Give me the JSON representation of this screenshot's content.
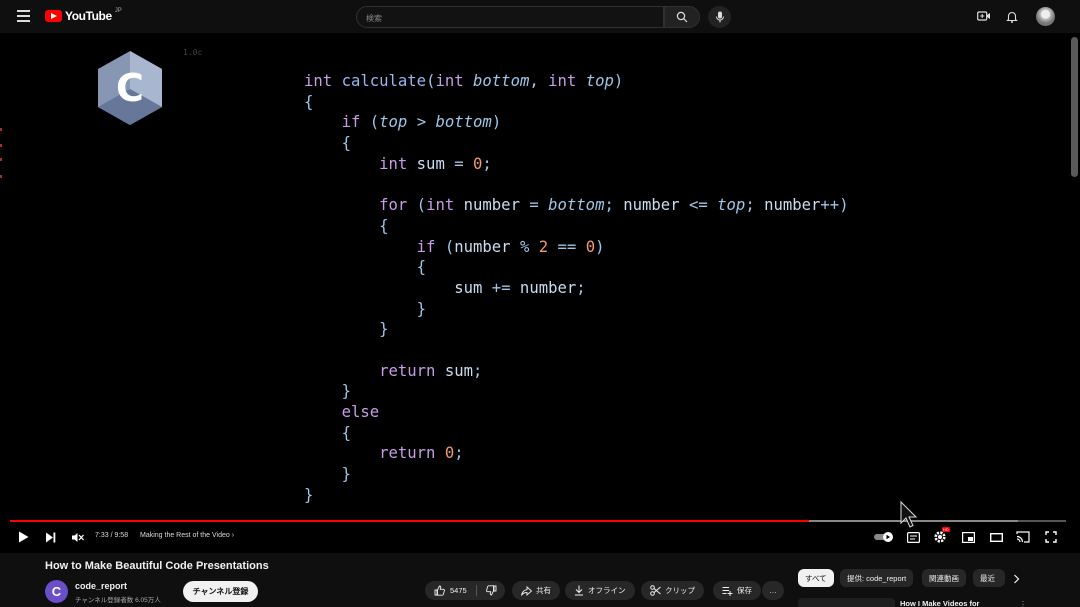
{
  "header": {
    "logo_text": "YouTube",
    "region": "JP",
    "search_placeholder": "検索"
  },
  "video": {
    "code_title": "1.0c",
    "logo_letter": "C",
    "code_lines": [
      [
        [
          "kw",
          "int"
        ],
        [
          "plain",
          " "
        ],
        [
          "fn",
          "calculate"
        ],
        [
          "punct",
          "("
        ],
        [
          "kw",
          "int"
        ],
        [
          "plain",
          " "
        ],
        [
          "param",
          "bottom"
        ],
        [
          "punct",
          ", "
        ],
        [
          "kw",
          "int"
        ],
        [
          "plain",
          " "
        ],
        [
          "param",
          "top"
        ],
        [
          "punct",
          ")"
        ]
      ],
      [
        [
          "punct",
          "{"
        ]
      ],
      [
        [
          "plain",
          "    "
        ],
        [
          "kw",
          "if"
        ],
        [
          "plain",
          " "
        ],
        [
          "punct",
          "("
        ],
        [
          "param",
          "top"
        ],
        [
          "plain",
          " "
        ],
        [
          "punct",
          ">"
        ],
        [
          "plain",
          " "
        ],
        [
          "param",
          "bottom"
        ],
        [
          "punct",
          ")"
        ]
      ],
      [
        [
          "plain",
          "    "
        ],
        [
          "punct",
          "{"
        ]
      ],
      [
        [
          "plain",
          "        "
        ],
        [
          "kw",
          "int"
        ],
        [
          "plain",
          " sum "
        ],
        [
          "punct",
          "="
        ],
        [
          "plain",
          " "
        ],
        [
          "num",
          "0"
        ],
        [
          "punct",
          ";"
        ]
      ],
      [],
      [
        [
          "plain",
          "        "
        ],
        [
          "kw",
          "for"
        ],
        [
          "plain",
          " "
        ],
        [
          "punct",
          "("
        ],
        [
          "kw",
          "int"
        ],
        [
          "plain",
          " number "
        ],
        [
          "punct",
          "="
        ],
        [
          "plain",
          " "
        ],
        [
          "param",
          "bottom"
        ],
        [
          "punct",
          ";"
        ],
        [
          "plain",
          " number "
        ],
        [
          "punct",
          "<="
        ],
        [
          "plain",
          " "
        ],
        [
          "param",
          "top"
        ],
        [
          "punct",
          ";"
        ],
        [
          "plain",
          " number"
        ],
        [
          "punct",
          "++)"
        ]
      ],
      [
        [
          "plain",
          "        "
        ],
        [
          "punct",
          "{"
        ]
      ],
      [
        [
          "plain",
          "            "
        ],
        [
          "kw",
          "if"
        ],
        [
          "plain",
          " "
        ],
        [
          "punct",
          "("
        ],
        [
          "plain",
          "number "
        ],
        [
          "punct",
          "%"
        ],
        [
          "plain",
          " "
        ],
        [
          "num",
          "2"
        ],
        [
          "plain",
          " "
        ],
        [
          "punct",
          "=="
        ],
        [
          "plain",
          " "
        ],
        [
          "num",
          "0"
        ],
        [
          "punct",
          ")"
        ]
      ],
      [
        [
          "plain",
          "            "
        ],
        [
          "punct",
          "{"
        ]
      ],
      [
        [
          "plain",
          "                sum "
        ],
        [
          "punct",
          "+="
        ],
        [
          "plain",
          " number"
        ],
        [
          "punct",
          ";"
        ]
      ],
      [
        [
          "plain",
          "            "
        ],
        [
          "punct",
          "}"
        ]
      ],
      [
        [
          "plain",
          "        "
        ],
        [
          "punct",
          "}"
        ]
      ],
      [],
      [
        [
          "plain",
          "        "
        ],
        [
          "kw",
          "return"
        ],
        [
          "plain",
          " sum"
        ],
        [
          "punct",
          ";"
        ]
      ],
      [
        [
          "plain",
          "    "
        ],
        [
          "punct",
          "}"
        ]
      ],
      [
        [
          "plain",
          "    "
        ],
        [
          "kw",
          "else"
        ]
      ],
      [
        [
          "plain",
          "    "
        ],
        [
          "punct",
          "{"
        ]
      ],
      [
        [
          "plain",
          "        "
        ],
        [
          "kw",
          "return"
        ],
        [
          "plain",
          " "
        ],
        [
          "num",
          "0"
        ],
        [
          "punct",
          ";"
        ]
      ],
      [
        [
          "plain",
          "    "
        ],
        [
          "punct",
          "}"
        ]
      ],
      [
        [
          "punct",
          "}"
        ]
      ]
    ]
  },
  "player": {
    "time": "7:33 / 9:58",
    "chapter": "Making the Rest of the Video",
    "chapter_chevron": "›",
    "progress_played_fraction": 0.757,
    "progress_loaded_fraction": 0.955,
    "settings_badge": "HD",
    "icons": [
      "play-icon",
      "next-icon",
      "mute-icon",
      "autoplay-toggle-icon",
      "subtitles-icon",
      "settings-icon",
      "miniplayer-icon",
      "theater-icon",
      "cast-icon",
      "fullscreen-icon"
    ]
  },
  "below": {
    "title": "How to Make Beautiful Code Presentations",
    "channel_name": "code_report",
    "channel_subs": "チャンネル登録者数 6.05万人",
    "channel_avatar_letter": "C",
    "subscribe_label": "チャンネル登録",
    "like_count": "5475",
    "share_label": "共有",
    "offline_label": "オフライン",
    "clip_label": "クリップ",
    "save_label": "保存",
    "more_label": "…",
    "chips": [
      "すべて",
      "提供: code_report",
      "関連動画",
      "最近"
    ],
    "rec_title": "How I Make Videos for",
    "rec_more": "⋮"
  },
  "colors": {
    "accent_red": "#ff0000",
    "code_keyword": "#c59ee6",
    "code_function": "#96b8f0",
    "code_number": "#f09a70",
    "code_text": "#c8ddf0",
    "channel_avatar": "#6b4fc9"
  }
}
